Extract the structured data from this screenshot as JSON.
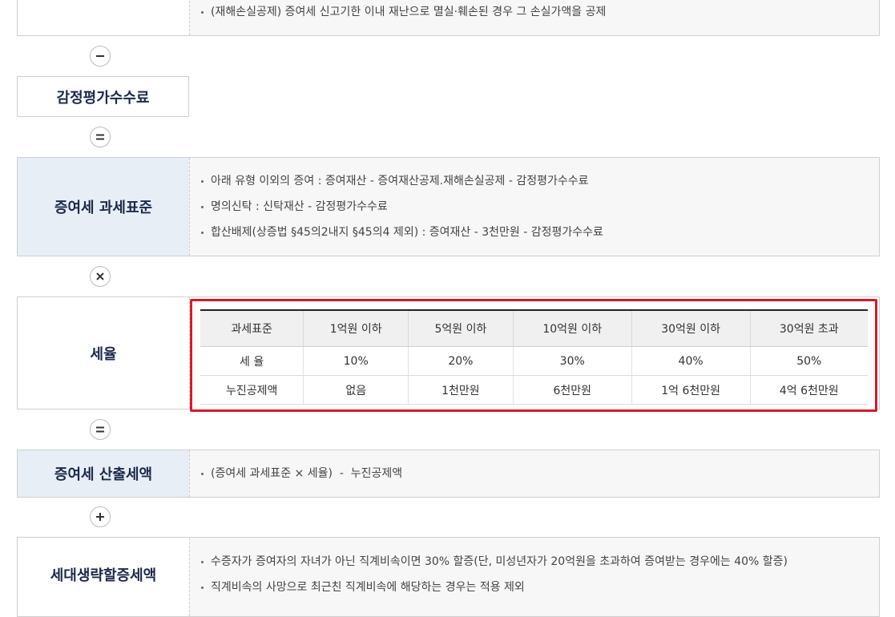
{
  "sections": {
    "disaster_loss": {
      "bullets": [
        "(재해손실공제) 증여세 신고기한 이내 재난으로 멸실·훼손된 경우 그 손실가액을 공제"
      ]
    },
    "appraisal_fee": {
      "label": "감정평가수수료"
    },
    "tax_base": {
      "label": "증여세 과세표준",
      "bullets": [
        "아래 유형 이외의 증여 : 증여재산 - 증여재산공제.재해손실공제 - 감정평가수수료",
        "명의신탁 : 신탁재산 - 감정평가수수료",
        "합산배제(상증법 §45의2내지 §45의4 제외) : 증여재산 - 3천만원 - 감정평가수수료"
      ]
    },
    "tax_rate": {
      "label": "세율",
      "table": {
        "headers": [
          "과세표준",
          "1억원 이하",
          "5억원 이하",
          "10억원 이하",
          "30억원 이하",
          "30억원 초과"
        ],
        "rows": [
          [
            "세 율",
            "10%",
            "20%",
            "30%",
            "40%",
            "50%"
          ],
          [
            "누진공제액",
            "없음",
            "1천만원",
            "6천만원",
            "1억 6천만원",
            "4억 6천만원"
          ]
        ]
      }
    },
    "calculated_tax": {
      "label": "증여세 산출세액",
      "bullets": [
        "(증여세 과세표준 × 세율)  -  누진공제액"
      ]
    },
    "generation_skip": {
      "label": "세대생략할증세액",
      "bullets": [
        "수증자가 증여자의 자녀가 아닌 직계비속이면 30% 할증(단, 미성년자가 20억원을 초과하여 증여받는 경우에는 40% 할증)",
        "직계비속의 사망으로 최근친 직계비속에 해당하는 경우는 적용 제외"
      ]
    }
  },
  "operators": {
    "minus": "minus-icon",
    "equals_1": "equals-icon",
    "times": "times-icon",
    "equals_2": "equals-icon",
    "plus": "plus-icon"
  },
  "colors": {
    "label_blue_bg": "#e8eef6",
    "label_text": "#1b2a4a",
    "highlight_border": "#d7192c"
  }
}
